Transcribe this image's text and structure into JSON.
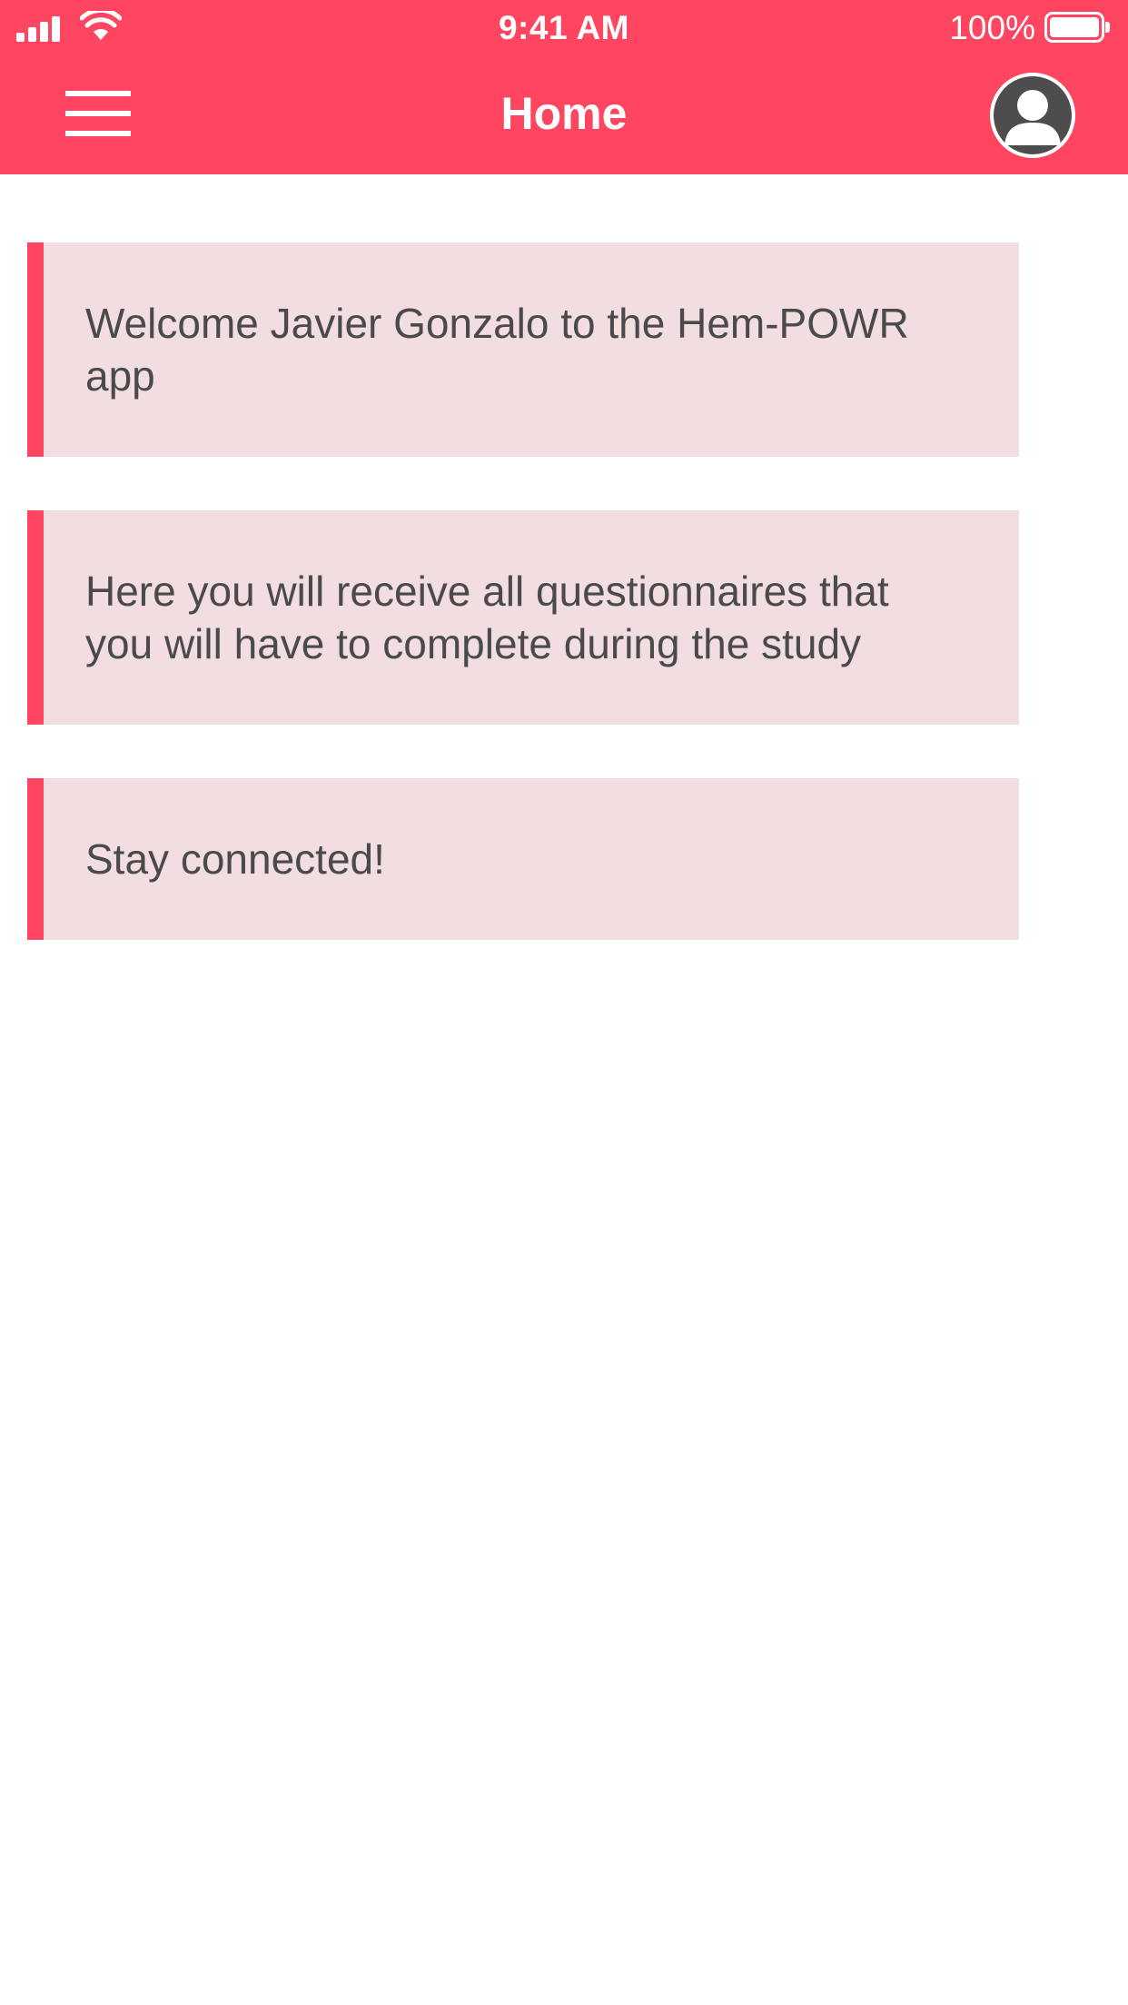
{
  "status_bar": {
    "time": "9:41 AM",
    "battery_percent": "100%",
    "signal_icon": "signal-bars-icon",
    "wifi_icon": "wifi-icon",
    "battery_icon": "battery-icon"
  },
  "nav": {
    "title": "Home",
    "menu_icon": "hamburger-menu-icon",
    "profile_icon": "user-avatar-icon"
  },
  "messages": [
    {
      "text": "Welcome Javier Gonzalo to the Hem-POWR app"
    },
    {
      "text": "Here you will receive all questionnaires that you will have to complete during the study"
    },
    {
      "text": "Stay connected!"
    }
  ],
  "colors": {
    "accent": "#ff4560",
    "card_background": "#f2dde1",
    "text": "#4a4a4a",
    "avatar": "#4d4d4d"
  }
}
